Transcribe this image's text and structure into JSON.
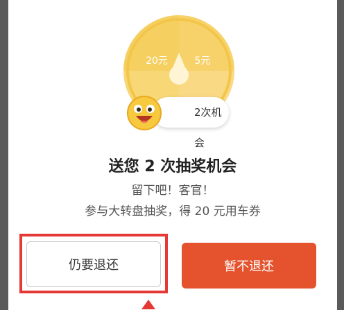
{
  "dialog": {
    "wheel": {
      "prize_left": "20元",
      "prize_right": "5元"
    },
    "chance_badge": "2次机会",
    "title": "送您 2 次抽奖机会",
    "subtitle_line1": "留下吧！客官！",
    "subtitle_line2": "参与大转盘抽奖，得 20 元用车券",
    "buttons": {
      "stay_label": "仍要退还",
      "return_label": "暂不退还"
    }
  },
  "colors": {
    "wheel_light": "#fde8a0",
    "wheel_dark": "#f6cc4c",
    "primary_button": "#e4532e",
    "highlight": "#e53935"
  }
}
